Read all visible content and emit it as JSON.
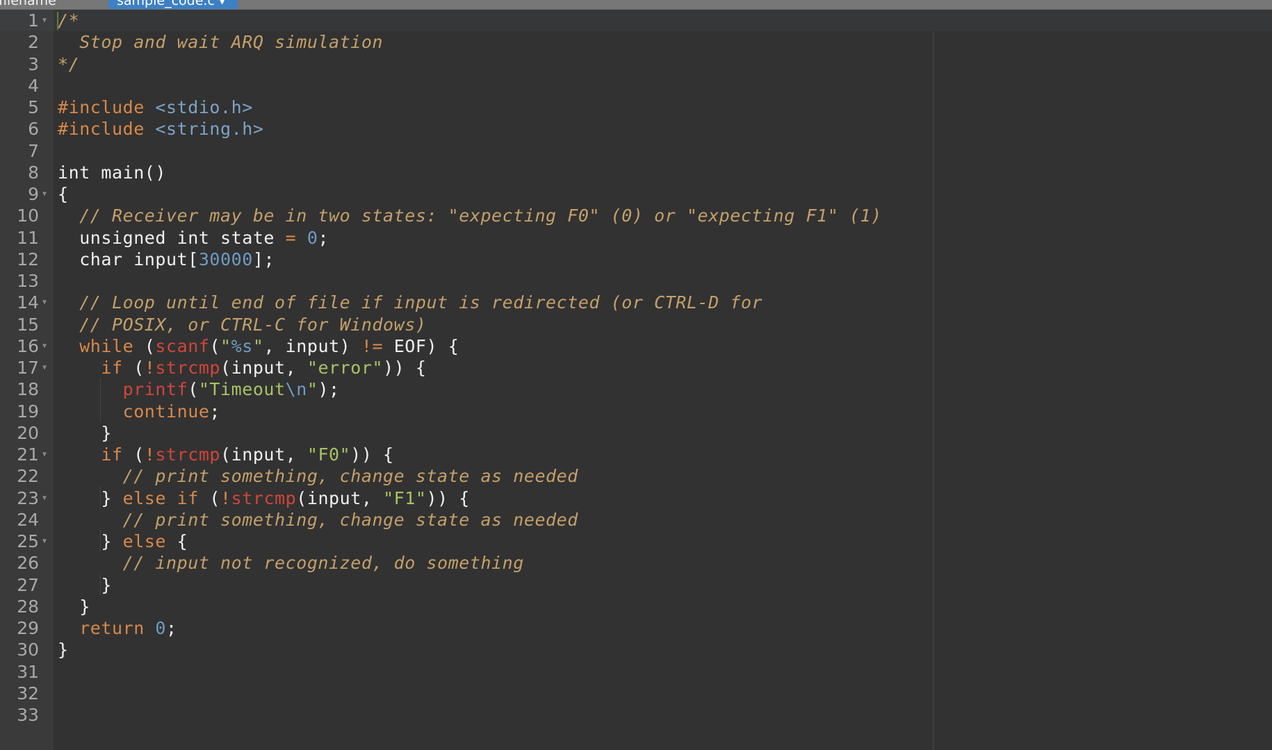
{
  "tabs": [
    {
      "label": "filename",
      "active": false
    },
    {
      "label": "sample_code.c",
      "active": true,
      "dropdown_icon": "chevron-down-icon"
    }
  ],
  "editor": {
    "language": "c",
    "active_line": 1,
    "line_count": 33,
    "fold_lines": [
      1,
      9,
      14,
      16,
      17,
      21,
      23,
      25
    ],
    "colors": {
      "background": "#323232",
      "gutter": "#3a3a3a",
      "comment": "#c4a06a",
      "keyword": "#d8884a",
      "function": "#d2453a",
      "string": "#a8c364",
      "number": "#6e9cc4",
      "tab_active": "#3d80c4",
      "tabbar": "#777777"
    },
    "lines": [
      [
        [
          "comment",
          "/*"
        ]
      ],
      [
        [
          "comment",
          "  Stop and wait ARQ simulation"
        ]
      ],
      [
        [
          "comment",
          "*/"
        ]
      ],
      [],
      [
        [
          "inc",
          "#include "
        ],
        [
          "hdr",
          "<stdio.h>"
        ]
      ],
      [
        [
          "inc",
          "#include "
        ],
        [
          "hdr",
          "<string.h>"
        ]
      ],
      [],
      [
        [
          "txt",
          "int main()"
        ]
      ],
      [
        [
          "txt",
          "{"
        ]
      ],
      [
        [
          "txt",
          "  "
        ],
        [
          "comment",
          "// Receiver may be in two states: \"expecting F0\" (0) or \"expecting F1\" (1)"
        ]
      ],
      [
        [
          "txt",
          "  unsigned int state "
        ],
        [
          "op",
          "="
        ],
        [
          "txt",
          " "
        ],
        [
          "num",
          "0"
        ],
        [
          "txt",
          ";"
        ]
      ],
      [
        [
          "txt",
          "  char input["
        ],
        [
          "num",
          "30000"
        ],
        [
          "txt",
          "];"
        ]
      ],
      [],
      [
        [
          "txt",
          "  "
        ],
        [
          "comment",
          "// Loop until end of file if input is redirected (or CTRL-D for"
        ]
      ],
      [
        [
          "txt",
          "  "
        ],
        [
          "comment",
          "// POSIX, or CTRL-C for Windows)"
        ]
      ],
      [
        [
          "txt",
          "  "
        ],
        [
          "kw",
          "while"
        ],
        [
          "txt",
          " ("
        ],
        [
          "fn",
          "scanf"
        ],
        [
          "txt",
          "("
        ],
        [
          "str",
          "\""
        ],
        [
          "num",
          "%s"
        ],
        [
          "str",
          "\""
        ],
        [
          "txt",
          ", input) "
        ],
        [
          "op",
          "!="
        ],
        [
          "txt",
          " EOF) {"
        ]
      ],
      [
        [
          "txt",
          "    "
        ],
        [
          "kw",
          "if"
        ],
        [
          "txt",
          " ("
        ],
        [
          "op",
          "!"
        ],
        [
          "fn",
          "strcmp"
        ],
        [
          "txt",
          "(input, "
        ],
        [
          "str",
          "\"error\""
        ],
        [
          "txt",
          ")) {"
        ]
      ],
      [
        [
          "txt",
          "      "
        ],
        [
          "fn",
          "printf"
        ],
        [
          "txt",
          "("
        ],
        [
          "str",
          "\"Timeout"
        ],
        [
          "esc",
          "\\n"
        ],
        [
          "str",
          "\""
        ],
        [
          "txt",
          ");"
        ]
      ],
      [
        [
          "txt",
          "      "
        ],
        [
          "kw",
          "continue"
        ],
        [
          "txt",
          ";"
        ]
      ],
      [
        [
          "txt",
          "    }"
        ]
      ],
      [
        [
          "txt",
          "    "
        ],
        [
          "kw",
          "if"
        ],
        [
          "txt",
          " ("
        ],
        [
          "op",
          "!"
        ],
        [
          "fn",
          "strcmp"
        ],
        [
          "txt",
          "(input, "
        ],
        [
          "str",
          "\"F0\""
        ],
        [
          "txt",
          ")) {"
        ]
      ],
      [
        [
          "txt",
          "      "
        ],
        [
          "comment",
          "// print something, change state as needed"
        ]
      ],
      [
        [
          "txt",
          "    } "
        ],
        [
          "kw",
          "else if"
        ],
        [
          "txt",
          " ("
        ],
        [
          "op",
          "!"
        ],
        [
          "fn",
          "strcmp"
        ],
        [
          "txt",
          "(input, "
        ],
        [
          "str",
          "\"F1\""
        ],
        [
          "txt",
          ")) {"
        ]
      ],
      [
        [
          "txt",
          "      "
        ],
        [
          "comment",
          "// print something, change state as needed"
        ]
      ],
      [
        [
          "txt",
          "    } "
        ],
        [
          "kw",
          "else"
        ],
        [
          "txt",
          " {"
        ]
      ],
      [
        [
          "txt",
          "      "
        ],
        [
          "comment",
          "// input not recognized, do something"
        ]
      ],
      [
        [
          "txt",
          "    }"
        ]
      ],
      [
        [
          "txt",
          "  }"
        ]
      ],
      [
        [
          "txt",
          "  "
        ],
        [
          "kw",
          "return"
        ],
        [
          "txt",
          " "
        ],
        [
          "num",
          "0"
        ],
        [
          "txt",
          ";"
        ]
      ],
      [
        [
          "txt",
          "}"
        ]
      ],
      [],
      [],
      []
    ]
  }
}
